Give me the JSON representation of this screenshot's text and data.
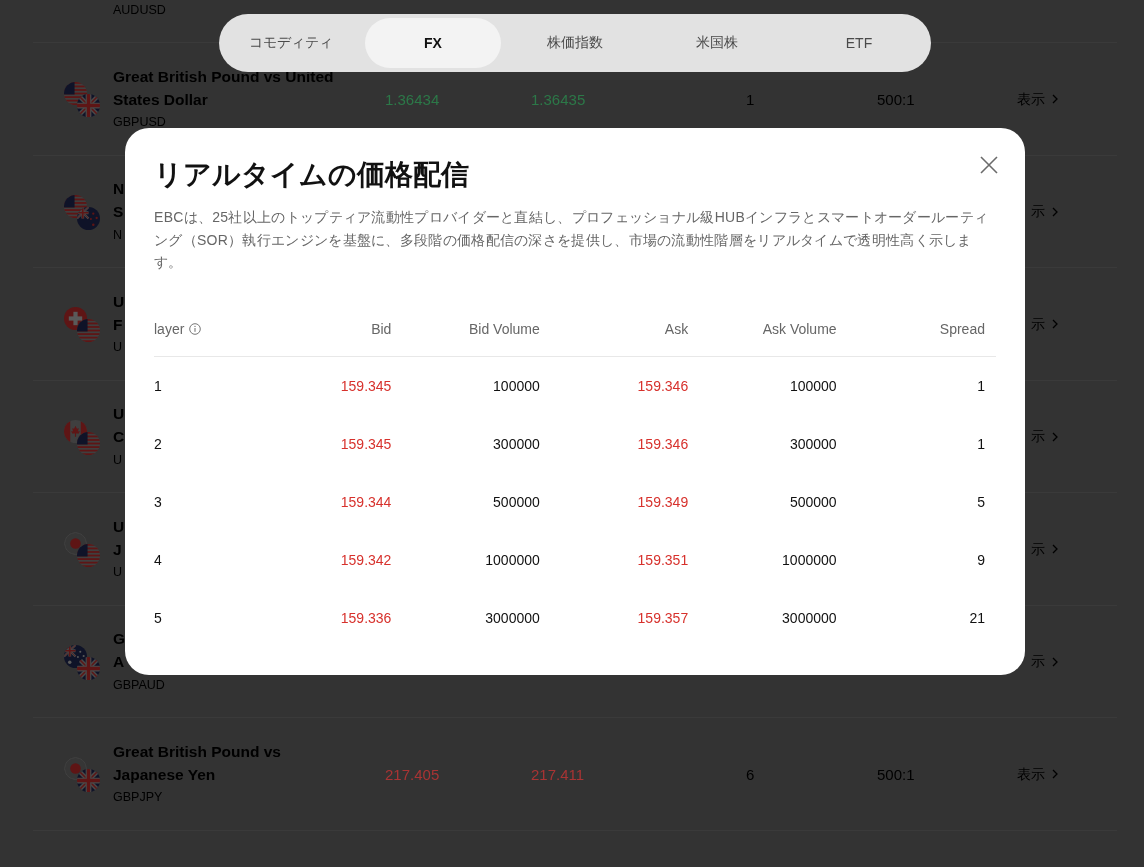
{
  "category_tabs": [
    {
      "label": "コモディティ",
      "selected": false
    },
    {
      "label": "FX",
      "selected": true
    },
    {
      "label": "株価指数",
      "selected": false
    },
    {
      "label": "米国株",
      "selected": false
    },
    {
      "label": "ETF",
      "selected": false
    }
  ],
  "instrument_list": {
    "rows": [
      {
        "code": "AUDUSD"
      },
      {
        "flags": [
          {
            "kind": "us"
          },
          {
            "kind": "gb"
          }
        ],
        "name_lines": [
          "Great British Pound vs United",
          "States Dollar"
        ],
        "code": "GBPUSD",
        "bid": "1.36434",
        "ask": "1.36435",
        "rising": true,
        "spread": "1",
        "leverage": "500:1",
        "view": "表示"
      },
      {
        "flags": [
          {
            "kind": "us"
          },
          {
            "kind": "nz"
          }
        ],
        "name_lines": [
          "N",
          "S"
        ],
        "code": "N",
        "view": "示"
      },
      {
        "flags": [
          {
            "kind": "ch"
          },
          {
            "kind": "us"
          }
        ],
        "name_lines": [
          "U",
          "F"
        ],
        "code": "U",
        "view": "示"
      },
      {
        "flags": [
          {
            "kind": "ca"
          },
          {
            "kind": "us"
          }
        ],
        "name_lines": [
          "U",
          "C"
        ],
        "code": "U",
        "view": "示"
      },
      {
        "flags": [
          {
            "kind": "jp"
          },
          {
            "kind": "us"
          }
        ],
        "name_lines": [
          "U",
          "J"
        ],
        "code": "U",
        "view": "示"
      },
      {
        "flags": [
          {
            "kind": "au"
          },
          {
            "kind": "gb"
          }
        ],
        "name_lines": [
          "G",
          "A"
        ],
        "code": "GBPAUD",
        "view": "示"
      },
      {
        "flags": [
          {
            "kind": "jp"
          },
          {
            "kind": "gb"
          }
        ],
        "name_lines": [
          "Great British Pound vs",
          "Japanese Yen"
        ],
        "code": "GBPJPY",
        "bid": "217.405",
        "ask": "217.411",
        "rising": false,
        "spread": "6",
        "leverage": "500:1",
        "view": "表示"
      }
    ]
  },
  "modal": {
    "title": "リアルタイムの価格配信",
    "description": "EBCは、25社以上のトップティア流動性プロバイダーと直結し、プロフェッショナル級HUBインフラとスマートオーダールーティング（SOR）執行エンジンを基盤に、多段階の価格配信の深さを提供し、市場の流動性階層をリアルタイムで透明性高く示します。",
    "table": {
      "columns": [
        {
          "label": "layer",
          "info": true
        },
        {
          "label": "Bid"
        },
        {
          "label": "Bid Volume"
        },
        {
          "label": "Ask"
        },
        {
          "label": "Ask Volume"
        },
        {
          "label": "Spread"
        }
      ],
      "rows": [
        {
          "layer": "1",
          "bid": "159.345",
          "bid_volume": "100000",
          "ask": "159.346",
          "ask_volume": "100000",
          "spread": "1"
        },
        {
          "layer": "2",
          "bid": "159.345",
          "bid_volume": "300000",
          "ask": "159.346",
          "ask_volume": "300000",
          "spread": "1"
        },
        {
          "layer": "3",
          "bid": "159.344",
          "bid_volume": "500000",
          "ask": "159.349",
          "ask_volume": "500000",
          "spread": "5"
        },
        {
          "layer": "4",
          "bid": "159.342",
          "bid_volume": "1000000",
          "ask": "159.351",
          "ask_volume": "1000000",
          "spread": "9"
        },
        {
          "layer": "5",
          "bid": "159.336",
          "bid_volume": "3000000",
          "ask": "159.357",
          "ask_volume": "3000000",
          "spread": "21"
        }
      ]
    }
  }
}
